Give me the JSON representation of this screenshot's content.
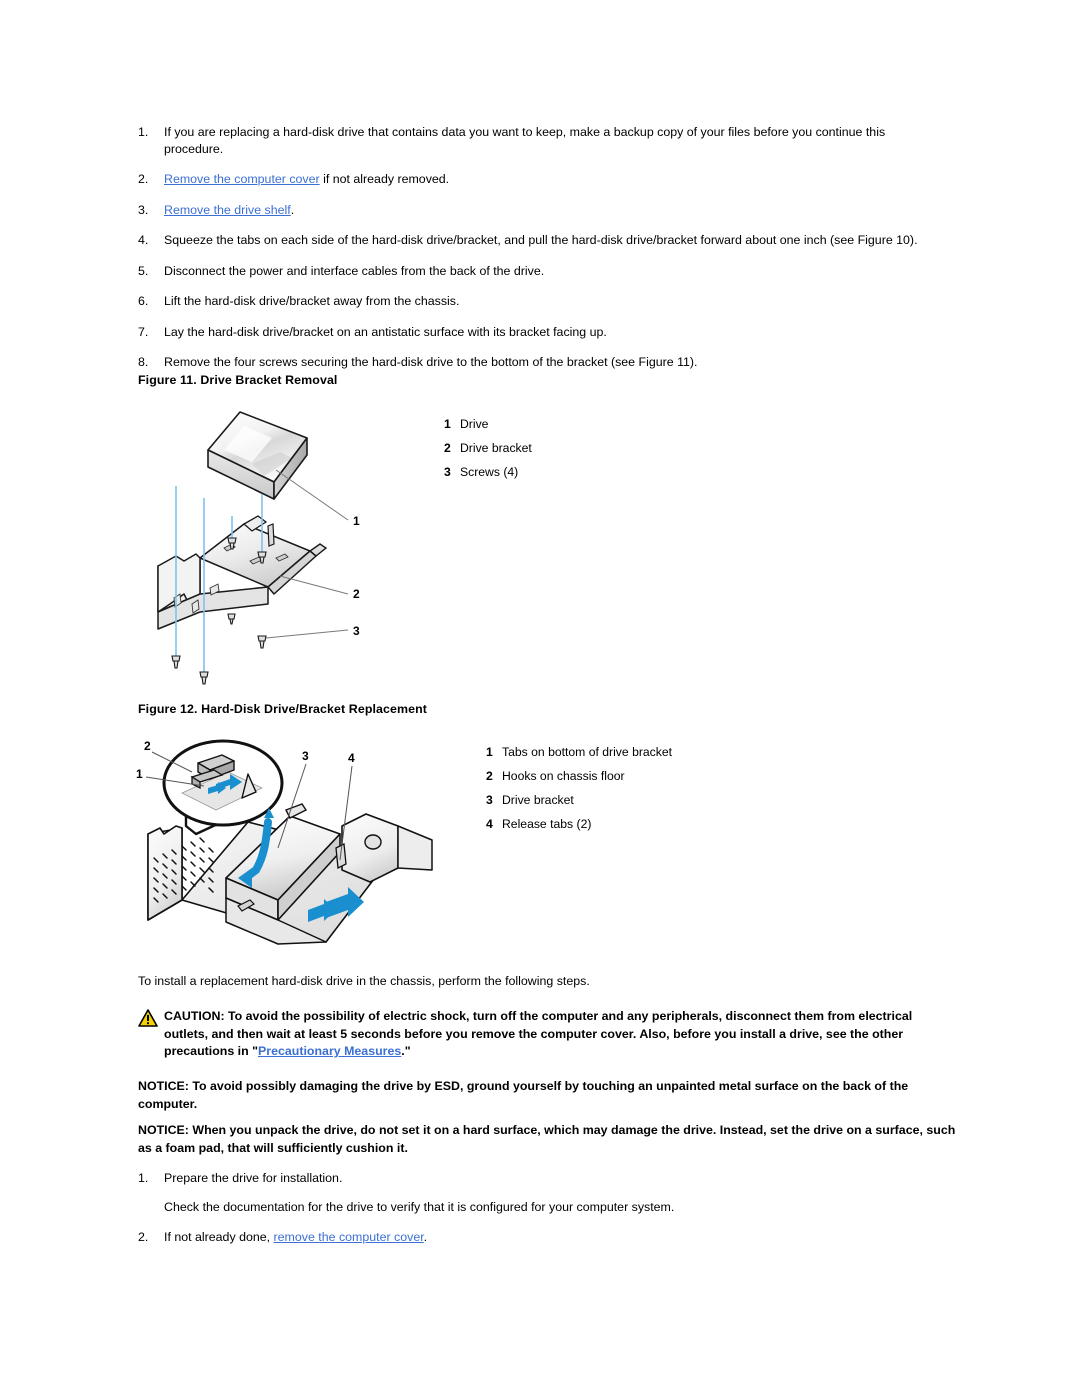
{
  "document": {
    "type": "service-manual-page",
    "link_color": "#3b6fd4",
    "accent_blue": "#1a8fd0"
  },
  "steps_top": [
    {
      "num": "1.",
      "text": "If you are replacing a hard-disk drive that contains data you want to keep, make a backup copy of your files before you continue this procedure."
    },
    {
      "num": "2.",
      "link": "Remove the computer cover",
      "text": " if not already removed."
    },
    {
      "num": "3.",
      "link": "Remove the drive shelf",
      "text": "."
    },
    {
      "num": "4.",
      "text": "Squeeze the tabs on each side of the hard-disk drive/bracket, and pull the hard-disk drive/bracket forward about one inch (see Figure 10)."
    },
    {
      "num": "5.",
      "text": "Disconnect the power and interface cables from the back of the drive."
    },
    {
      "num": "6.",
      "text": "Lift the hard-disk drive/bracket away from the chassis."
    },
    {
      "num": "7.",
      "text": "Lay the hard-disk drive/bracket on an antistatic surface with its bracket facing up."
    },
    {
      "num": "8.",
      "text": "Remove the four screws securing the hard-disk drive to the bottom of the bracket (see Figure 11)."
    }
  ],
  "figure11": {
    "caption": "Figure 11. Drive Bracket Removal",
    "legend": [
      {
        "num": "1",
        "label": "Drive"
      },
      {
        "num": "2",
        "label": "Drive bracket"
      },
      {
        "num": "3",
        "label": "Screws (4)"
      }
    ],
    "callouts": [
      "1",
      "2",
      "3"
    ]
  },
  "figure12": {
    "caption": "Figure 12. Hard-Disk Drive/Bracket Replacement",
    "legend": [
      {
        "num": "1",
        "label": "Tabs on bottom of drive bracket"
      },
      {
        "num": "2",
        "label": "Hooks on chassis floor"
      },
      {
        "num": "3",
        "label": "Drive bracket"
      },
      {
        "num": "4",
        "label": "Release tabs (2)"
      }
    ],
    "callouts": [
      "1",
      "2",
      "3",
      "4"
    ]
  },
  "intro_para": "To install a replacement hard-disk drive in the chassis, perform the following steps.",
  "caution": {
    "icon": "warning-triangle-icon",
    "text_before_link": "CAUTION: To avoid the possibility of electric shock, turn off the computer and any peripherals, disconnect them from electrical outlets, and then wait at least 5 seconds before you remove the computer cover. Also, before you install a drive, see the other precautions in \"",
    "link": "Precautionary Measures",
    "text_after_link": ".\""
  },
  "notices": [
    "NOTICE: To avoid possibly damaging the drive by ESD, ground yourself by touching an unpainted metal surface on the back of the computer.",
    "NOTICE: When you unpack the drive, do not set it on a hard surface, which may damage the drive. Instead, set the drive on a surface, such as a foam pad, that will sufficiently cushion it."
  ],
  "steps_bottom": [
    {
      "num": "1.",
      "text": "Prepare the drive for installation."
    },
    {
      "num": "2.",
      "text_before_link": "If not already done, ",
      "link": "remove the computer cover",
      "text_after_link": "."
    }
  ],
  "steps_bottom_sub": "Check the documentation for the drive to verify that it is configured for your computer system."
}
